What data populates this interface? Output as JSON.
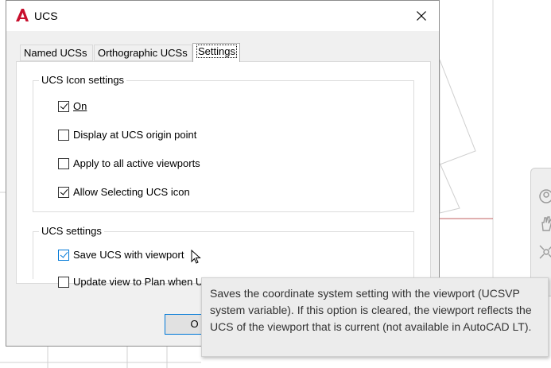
{
  "dialog": {
    "title": "UCS",
    "close_label": "×"
  },
  "tabs": [
    {
      "label": "Named UCSs",
      "active": false
    },
    {
      "label": "Orthographic UCSs",
      "active": false
    },
    {
      "label": "Settings",
      "active": true
    }
  ],
  "icon_group": {
    "title": "UCS Icon settings",
    "options": [
      {
        "label": "On",
        "checked": true
      },
      {
        "label": "Display at UCS origin point",
        "checked": false
      },
      {
        "label": "Apply to all active viewports",
        "checked": false
      },
      {
        "label": "Allow Selecting UCS icon",
        "checked": true
      }
    ]
  },
  "ucs_group": {
    "title": "UCS settings",
    "options": [
      {
        "label": "Save UCS with viewport",
        "checked": true
      },
      {
        "label": "Update view to Plan when U",
        "checked": false
      }
    ]
  },
  "buttons": {
    "ok_partial": "O"
  },
  "tooltip": {
    "text": "Saves the coordinate system setting with the viewport (UCSVP system variable). If this option is cleared, the viewport reflects the UCS of the viewport that is current (not available in AutoCAD LT)."
  },
  "colors": {
    "accent": "#0078d7",
    "app_icon": "#c8102e",
    "drawing_line": "#c06060"
  }
}
